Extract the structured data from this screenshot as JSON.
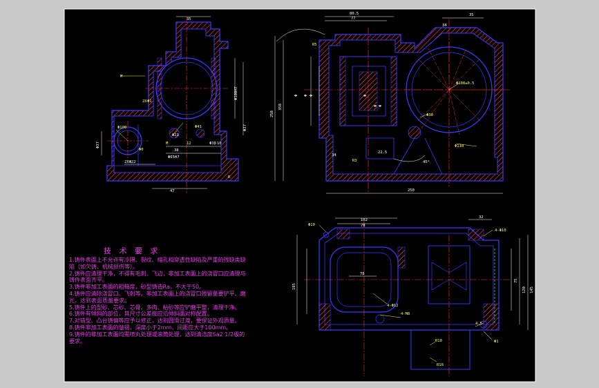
{
  "colors": {
    "background_outer": "#c9c9c9",
    "sheet": "#000000",
    "frame": "#ffffff",
    "outline": "#3a3aff",
    "hatch": "#ff4040",
    "centerline": "#ff3030",
    "dimension": "#ffffff",
    "leader": "#ffff40",
    "notes": "#e040e0"
  },
  "technical_requirements": {
    "title": "技 术 要 求",
    "items": [
      "1.铸件表面上不允许有冷隔、裂纹、缩孔和穿透性缺陷及严重的残缺类缺陷（如欠铸、机械损伤等）。",
      "2.铸件应清理干净，不得有毛刺、飞边，非加工表面上的浇冒口应清理与铸件表面齐平。",
      "3.铸件非加工表面的粗糙度，砂型铸造Ra，不大于50。",
      "4.铸件应清除浇冒口、飞刺等。非加工表面上的浇冒口残留量要铲平、磨光，达到表面质量要求。",
      "5.铸件上的型砂、芯砂、芯骨、多肉、粘砂等应铲磨平整，清理干净。",
      "6.铸件有倾斜的部位，其尺寸公差按应沿倾斜面对称配置。",
      "7.对错型、凸台铸偏等应予以修正，达到圆滑过渡，要保证外观质量。",
      "8.铸件非加工表面的皱褶，深度小于2mm，间距应大于100mm。",
      "9.铸件的非加工表面均需喷丸处理或滚筒处理，达到清洁度Sa2 1/2级的要求。"
    ]
  },
  "dimensions": {
    "left_view": [
      "35",
      "Φ100H7",
      "Φ37",
      "Φ41",
      "Φ38",
      "M",
      "12",
      "M",
      "10",
      "2XΦ22",
      "2X",
      "Φ1",
      "38",
      "Φ0",
      "Φ100",
      "Φ65H7",
      "Φ37",
      "Φ21",
      "R",
      "47"
    ],
    "front_view": [
      "80.5",
      "77",
      "35",
      "34",
      "Φ",
      "Φ",
      "Φ",
      "Φ",
      "Φ30",
      "R5",
      "Φ108±0.5",
      "Φ110",
      "Φ",
      "Φ",
      "22.5",
      "34",
      "R3",
      "45°",
      "258",
      "358",
      "250"
    ],
    "top_view": [
      "102",
      "78",
      "32",
      "Φ10",
      "4-Φ10",
      "78",
      "4-M8",
      "4-Φ12",
      "R10",
      "R10",
      "Φ1",
      "4.5",
      "185",
      "75",
      "120",
      "145"
    ]
  }
}
